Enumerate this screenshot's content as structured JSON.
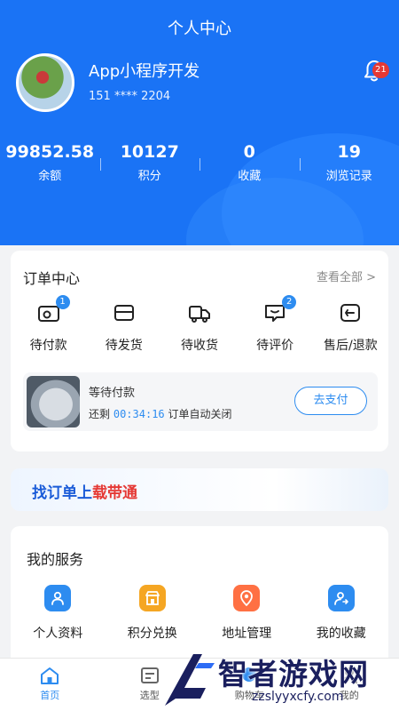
{
  "header": {
    "title": "个人中心",
    "username": "App小程序开发",
    "phone": "151 **** 2204",
    "notification_count": "21",
    "stats": [
      {
        "value": "99852.58",
        "label": "余额"
      },
      {
        "value": "10127",
        "label": "积分"
      },
      {
        "value": "0",
        "label": "收藏"
      },
      {
        "value": "19",
        "label": "浏览记录"
      }
    ]
  },
  "orders": {
    "title": "订单中心",
    "view_all": "查看全部 >",
    "items": [
      {
        "label": "待付款",
        "icon": "wallet-icon",
        "badge": "1"
      },
      {
        "label": "待发货",
        "icon": "card-icon",
        "badge": ""
      },
      {
        "label": "待收货",
        "icon": "truck-icon",
        "badge": ""
      },
      {
        "label": "待评价",
        "icon": "comment-icon",
        "badge": "2"
      },
      {
        "label": "售后/退款",
        "icon": "return-icon",
        "badge": ""
      }
    ],
    "pending": {
      "title": "等待付款",
      "prefix": "还剩",
      "timer": "00:34:16",
      "suffix": "订单自动关闭",
      "button": "去支付"
    }
  },
  "banner": {
    "part1": "找订单上",
    "part2": "载带通"
  },
  "services": {
    "title": "我的服务",
    "items": [
      {
        "label": "个人资料",
        "icon": "profile-icon",
        "color": "#2d8cf0"
      },
      {
        "label": "积分兑换",
        "icon": "shop-icon",
        "color": "#f5a623"
      },
      {
        "label": "地址管理",
        "icon": "address-icon",
        "color": "#ff7043"
      },
      {
        "label": "我的收藏",
        "icon": "favorite-icon",
        "color": "#2d8cf0"
      }
    ]
  },
  "tabbar": [
    {
      "label": "首页",
      "icon": "home-icon",
      "active": true
    },
    {
      "label": "选型",
      "icon": "select-icon",
      "active": false
    },
    {
      "label": "购物车",
      "icon": "cart-icon",
      "active": false
    },
    {
      "label": "我的",
      "icon": "user-icon",
      "active": false
    }
  ],
  "watermark": {
    "title": "智者游戏网",
    "url": "zzslyyxcfy.com"
  },
  "colors": {
    "primary": "#1a73f5",
    "accent": "#2d8cf0",
    "badge_red": "#e53935"
  }
}
